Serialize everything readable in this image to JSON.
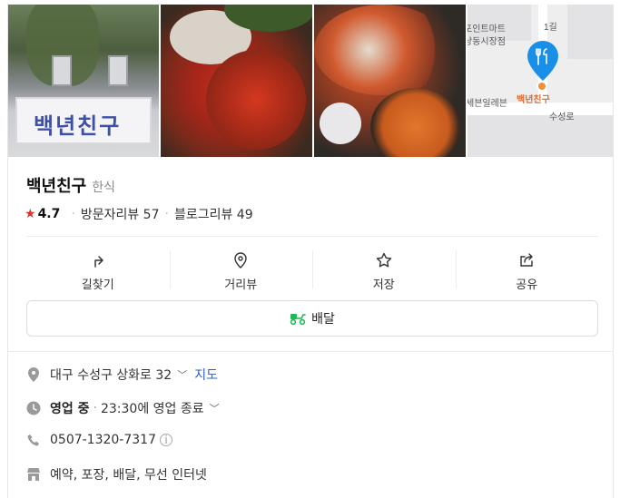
{
  "place": {
    "name": "백년친구",
    "category": "한식",
    "rating": "4.7",
    "visitor_reviews": "방문자리뷰 57",
    "blog_reviews": "블로그리뷰 49"
  },
  "photos": {
    "sign_text": "백년친구",
    "map_labels": [
      "포인트마트",
      "상동시장점",
      "세븐일레븐",
      "수성로",
      "백년친구",
      "1길"
    ]
  },
  "actions": [
    {
      "label": "길찾기",
      "icon": "directions-icon"
    },
    {
      "label": "거리뷰",
      "icon": "location-pin-icon"
    },
    {
      "label": "저장",
      "icon": "star-icon"
    },
    {
      "label": "공유",
      "icon": "share-icon"
    }
  ],
  "delivery": {
    "label": "배달",
    "icon": "scooter-icon"
  },
  "info": {
    "address": "대구 수성구 상화로 32",
    "map_link": "지도",
    "status": "영업 중",
    "hours": "23:30에 영업 종료",
    "phone": "0507-1320-7317",
    "amenities": "예약, 포장, 배달, 무선 인터넷"
  },
  "colors": {
    "accent_star": "#e0312e",
    "link": "#2b5fc7",
    "map_pin": "#1a8fe8",
    "delivery_icon": "#1db954"
  }
}
